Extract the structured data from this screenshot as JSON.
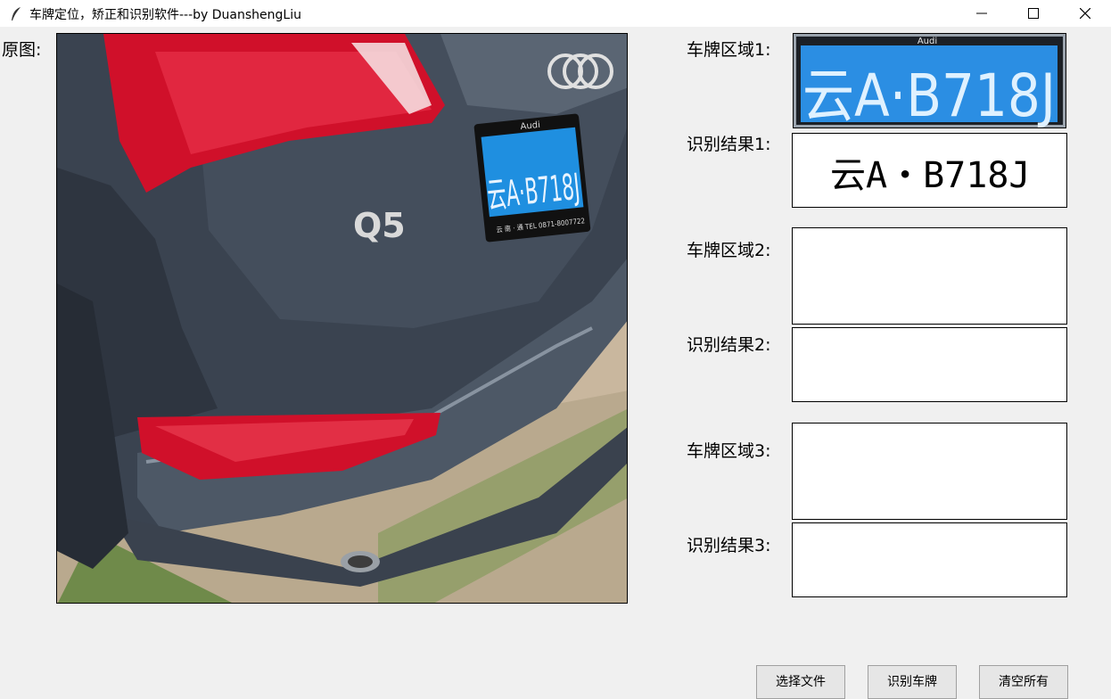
{
  "window": {
    "title": "车牌定位，矫正和识别软件---by DuanshengLiu"
  },
  "labels": {
    "original": "原图:",
    "plate_region_1": "车牌区域1:",
    "result_1": "识别结果1:",
    "plate_region_2": "车牌区域2:",
    "result_2": "识别结果2:",
    "plate_region_3": "车牌区域3:",
    "result_3": "识别结果3:"
  },
  "photo": {
    "car_badge": "Q5",
    "brand_small": "Audi",
    "plate_text": "云A·B718J",
    "dealer_text": "云 南 · 通    TEL 0871-8007722"
  },
  "plate_crop": {
    "brand_small": "Audi",
    "text": "云A·B718J"
  },
  "results": {
    "result_1": "云A・B718J",
    "result_2": "",
    "result_3": ""
  },
  "buttons": {
    "select_file": "选择文件",
    "recognize": "识别车牌",
    "clear_all": "清空所有"
  },
  "colors": {
    "background": "#f0f0f0",
    "plate_blue": "#1f8fe0",
    "car_body": "#3a4350",
    "taillight": "#d0102a"
  }
}
